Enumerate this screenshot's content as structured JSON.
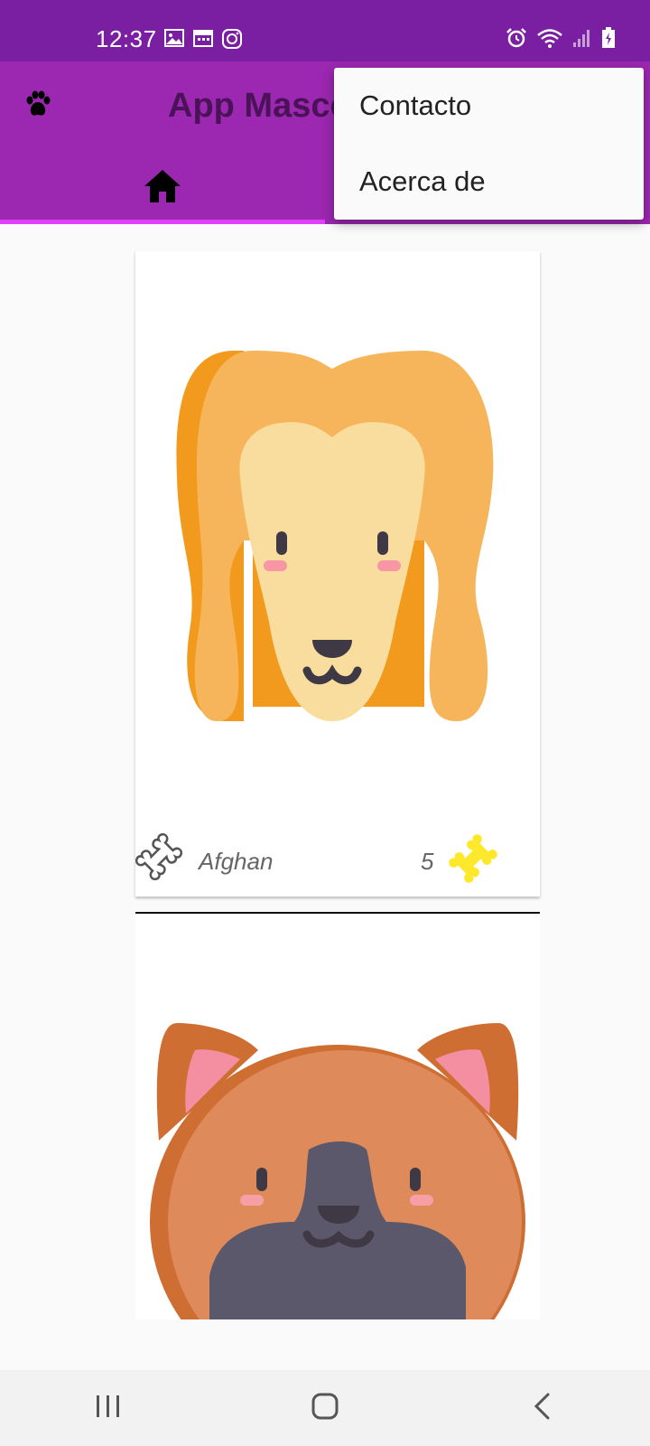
{
  "status_bar": {
    "time": "12:37",
    "left_icons": [
      "gallery-icon",
      "calendar-icon",
      "instagram-icon"
    ],
    "right_icons": [
      "alarm-icon",
      "wifi-icon",
      "signal-icon",
      "battery-charging-icon"
    ]
  },
  "app_bar": {
    "logo_icon": "paw-icon",
    "title": "App Masco",
    "tabs": [
      {
        "icon": "home-icon",
        "selected": true
      }
    ]
  },
  "overflow_menu": {
    "items": [
      {
        "label": "Contacto"
      },
      {
        "label": "Acerca de"
      }
    ]
  },
  "pets": [
    {
      "name": "Afghan",
      "rating": "5",
      "image": "afghan-dog-face"
    },
    {
      "name": "",
      "rating": "",
      "image": "shiba-dog-face"
    }
  ],
  "nav_bar": {
    "buttons": [
      "recent-apps-icon",
      "home-button-icon",
      "back-icon"
    ]
  },
  "colors": {
    "status_bar": "#7b1fa2",
    "app_bar": "#9c27b0",
    "tab_indicator": "#e040fb",
    "title": "#4a1257"
  }
}
